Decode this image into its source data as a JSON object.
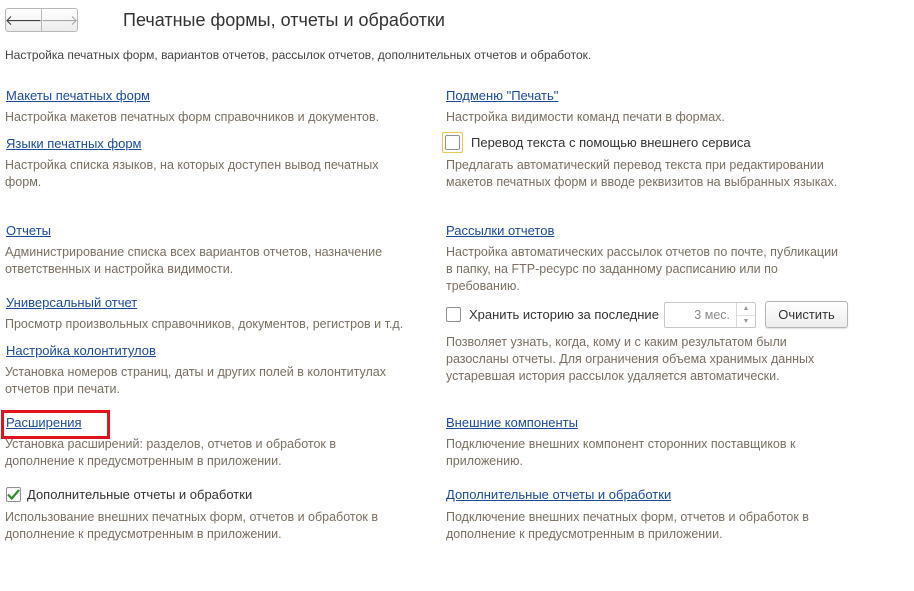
{
  "header": {
    "back_icon": "arrow-left",
    "forward_icon": "arrow-right",
    "title": "Печатные формы, отчеты и обработки",
    "subtitle": "Настройка печатных форм, вариантов отчетов, рассылок отчетов, дополнительных отчетов и обработок."
  },
  "left": {
    "print_layouts": {
      "link": "Макеты печатных форм",
      "desc": "Настройка макетов печатных форм справочников и документов."
    },
    "print_languages": {
      "link": "Языки печатных форм",
      "desc": "Настройка списка языков, на которых доступен вывод печатных форм."
    },
    "reports": {
      "link": "Отчеты",
      "desc": "Администрирование списка всех вариантов отчетов, назначение ответственных и настройка видимости."
    },
    "universal_report": {
      "link": "Универсальный отчет",
      "desc": "Просмотр произвольных справочников, документов, регистров и т.д."
    },
    "headers_footers": {
      "link": "Настройка колонтитулов",
      "desc": "Установка номеров страниц, даты и других полей в колонтитулах отчетов при печати."
    },
    "extensions": {
      "link": "Расширения",
      "desc": "Установка расширений: разделов, отчетов и обработок в дополнение к предусмотренным в приложении."
    },
    "additional": {
      "checkbox_label": "Дополнительные отчеты и обработки",
      "checked": true,
      "desc": "Использование внешних печатных форм, отчетов и обработок в дополнение к предусмотренным в приложении."
    }
  },
  "right": {
    "print_submenu": {
      "link": "Подменю \"Печать\"",
      "desc": "Настройка видимости команд печати в формах."
    },
    "translation": {
      "checkbox_label": "Перевод текста с помощью внешнего сервиса",
      "checked": false,
      "desc": "Предлагать автоматический перевод текста при редактировании макетов печатных форм и вводе реквизитов на выбранных языках."
    },
    "mailings": {
      "link": "Рассылки отчетов",
      "desc": "Настройка автоматических рассылок отчетов по почте, публикации в папку, на FTP-ресурс по заданному расписанию или по требованию."
    },
    "history": {
      "checkbox_label": "Хранить историю за последние",
      "checked": false,
      "spin_value": "3 мес.",
      "clear_label": "Очистить",
      "desc": "Позволяет узнать, когда, кому и с каким результатом были разосланы отчеты. Для ограничения объема хранимых данных устаревшая история рассылок удаляется автоматически."
    },
    "external_components": {
      "link": "Внешние компоненты",
      "desc": "Подключение внешних компонент сторонних поставщиков к приложению."
    },
    "additional_link": {
      "link": "Дополнительные отчеты и обработки",
      "desc": "Подключение внешних печатных форм, отчетов и обработок в дополнение к предусмотренным в приложении."
    }
  },
  "colors": {
    "link": "#1c4a9a",
    "desc": "#7a6f60",
    "highlight_frame": "#e0141e",
    "checkmark": "#2e8b2e"
  }
}
